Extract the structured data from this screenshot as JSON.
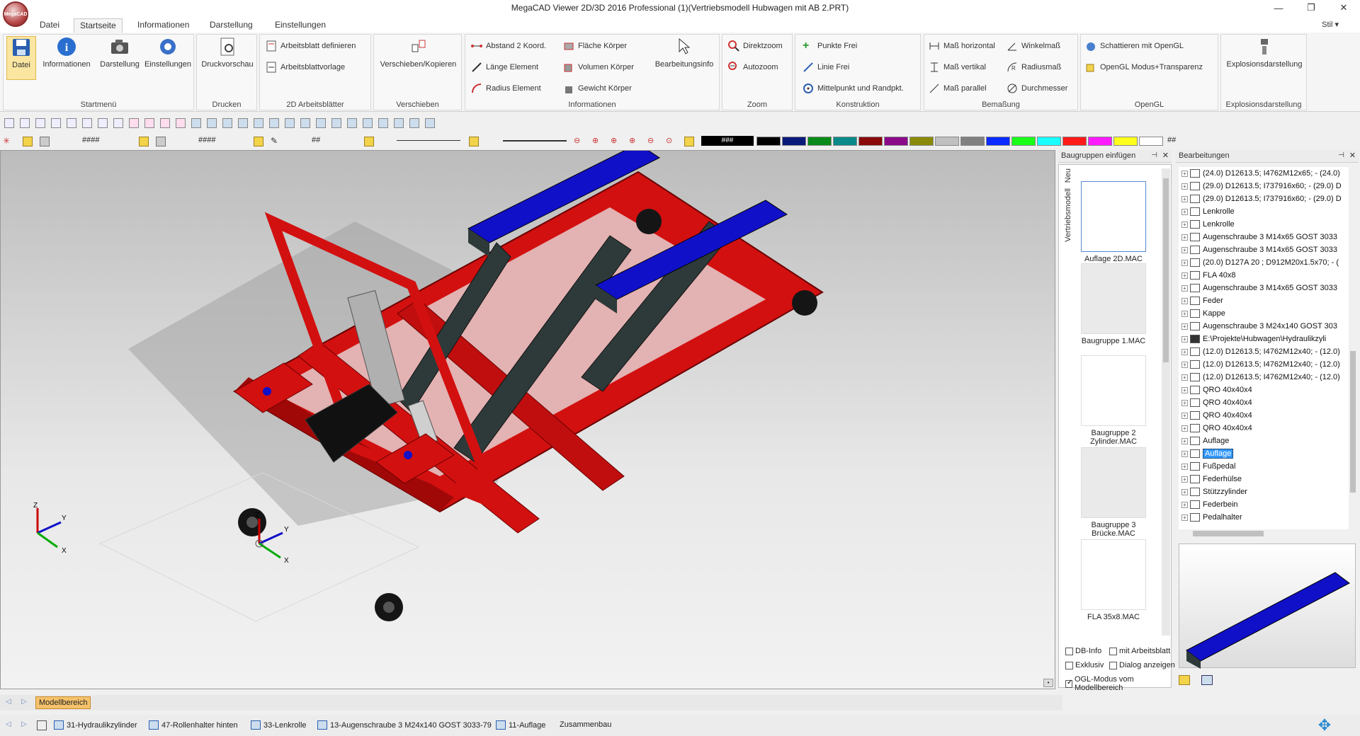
{
  "window": {
    "title": "MegaCAD Viewer 2D/3D 2016 Professional (1)(Vertriebsmodell Hubwagen mit AB 2.PRT)",
    "logo_text": "MegaCAD",
    "controls": [
      "minimize-icon",
      "restore-icon",
      "close-icon"
    ]
  },
  "menu": {
    "tabs": [
      "Datei",
      "Startseite",
      "Informationen",
      "Darstellung",
      "Einstellungen"
    ],
    "active": "Startseite",
    "style_label": "Stil"
  },
  "ribbon": {
    "startmenu": {
      "label": "Startmenü",
      "buttons": [
        "Datei",
        "Informationen",
        "Darstellung",
        "Einstellungen"
      ]
    },
    "drucken": {
      "label": "Drucken",
      "buttons": [
        "Druckvorschau"
      ]
    },
    "arbeitsblatt": {
      "label": "2D Arbeitsblätter",
      "buttons": [
        "Arbeitsblatt definieren",
        "Arbeitsblattvorlage"
      ]
    },
    "verschieben": {
      "label": "Verschieben",
      "buttons": [
        "Verschieben/Kopieren"
      ]
    },
    "informationen": {
      "label": "Informationen",
      "buttons": [
        "Abstand 2 Koord.",
        "Länge Element",
        "Radius Element",
        "Fläche Körper",
        "Volumen Körper",
        "Gewicht Körper",
        "Bearbeitungsinfo"
      ]
    },
    "zoom": {
      "label": "Zoom",
      "buttons": [
        "Direktzoom",
        "Autozoom"
      ]
    },
    "konstruktion": {
      "label": "Konstruktion",
      "buttons": [
        "Punkte Frei",
        "Linie Frei",
        "Mittelpunkt und Randpkt."
      ]
    },
    "bemassung": {
      "label": "Bemaßung",
      "buttons": [
        "Maß horizontal",
        "Maß vertikal",
        "Maß parallel",
        "Winkelmaß",
        "Radiusmaß",
        "Durchmesser"
      ]
    },
    "opengl": {
      "label": "OpenGL",
      "buttons": [
        "Schattieren mit OpenGL",
        "OpenGL Modus+Transparenz"
      ]
    },
    "explosion": {
      "label": "Explosionsdarstellung",
      "buttons": [
        "Explosionsdarstellung"
      ]
    }
  },
  "toolbar2": {
    "field1": "####",
    "field2": "####",
    "field3": "##",
    "field4": "###",
    "field5": "##",
    "colors": [
      "#000000",
      "#000000",
      "#0a1a7a",
      "#0a8a1a",
      "#0a8a8a",
      "#8a0a0a",
      "#8a0a8a",
      "#8a8a0a",
      "#c0c0c0",
      "#808080",
      "#0a2aff",
      "#1aff1a",
      "#1affff",
      "#ff1a1a",
      "#ff1aff",
      "#ffff1a",
      "#ffffff"
    ]
  },
  "baugruppen_panel": {
    "title": "Baugruppen einfügen",
    "vertical_tabs": [
      "Neu",
      "Vertriebsmodell"
    ],
    "thumbnails": [
      "Auflage 2D.MAC",
      "Baugruppe 1.MAC",
      "Baugruppe 2 Zylinder.MAC",
      "Baugruppe 3 Brücke.MAC",
      "FLA 35x8.MAC"
    ],
    "checkboxes": [
      {
        "label": "DB-Info",
        "checked": false
      },
      {
        "label": "mit Arbeitsblatt",
        "checked": false
      },
      {
        "label": "Exklusiv",
        "checked": false
      },
      {
        "label": "Dialog anzeigen",
        "checked": false
      },
      {
        "label": "OGL-Modus vom Modellbereich",
        "checked": true
      }
    ]
  },
  "bearbeitungen_panel": {
    "title": "Bearbeitungen",
    "items": [
      "(24.0) D12613.5; I4762M12x65; - (24.0)",
      "(29.0) D12613.5; I737916x60; - (29.0) D",
      "(29.0) D12613.5; I737916x60; - (29.0) D",
      "Lenkrolle",
      "Lenkrolle",
      "Augenschraube 3 M14x65 GOST 3033",
      "Augenschraube 3 M14x65 GOST 3033",
      "(20.0) D127A 20 ; D912M20x1.5x70; - (",
      "FLA 40x8",
      "Augenschraube 3 M14x65 GOST 3033",
      "Feder",
      "Kappe",
      "Augenschraube 3 M24x140 GOST 303",
      "E:\\Projekte\\Hubwagen\\Hydraulikzyli",
      "(12.0) D12613.5; I4762M12x40; - (12.0)",
      "(12.0) D12613.5; I4762M12x40; - (12.0)",
      "(12.0) D12613.5; I4762M12x40; - (12.0)",
      "QRO 40x40x4",
      "QRO 40x40x4",
      "QRO 40x40x4",
      "QRO 40x40x4",
      "Auflage",
      "Auflage",
      "Fußpedal",
      "Federhülse",
      "Stützzylinder",
      "Federbein",
      "Pedalhalter"
    ],
    "selected_index": 22
  },
  "status": {
    "model_tab": "Modellbereich",
    "tabs": [
      "31-Hydraulikzylinder",
      "47-Rollenhalter hinten",
      "33-Lenkrolle",
      "13-Augenschraube 3 M24x140 GOST 3033-79",
      "11-Auflage",
      "Zusammenbau"
    ]
  }
}
